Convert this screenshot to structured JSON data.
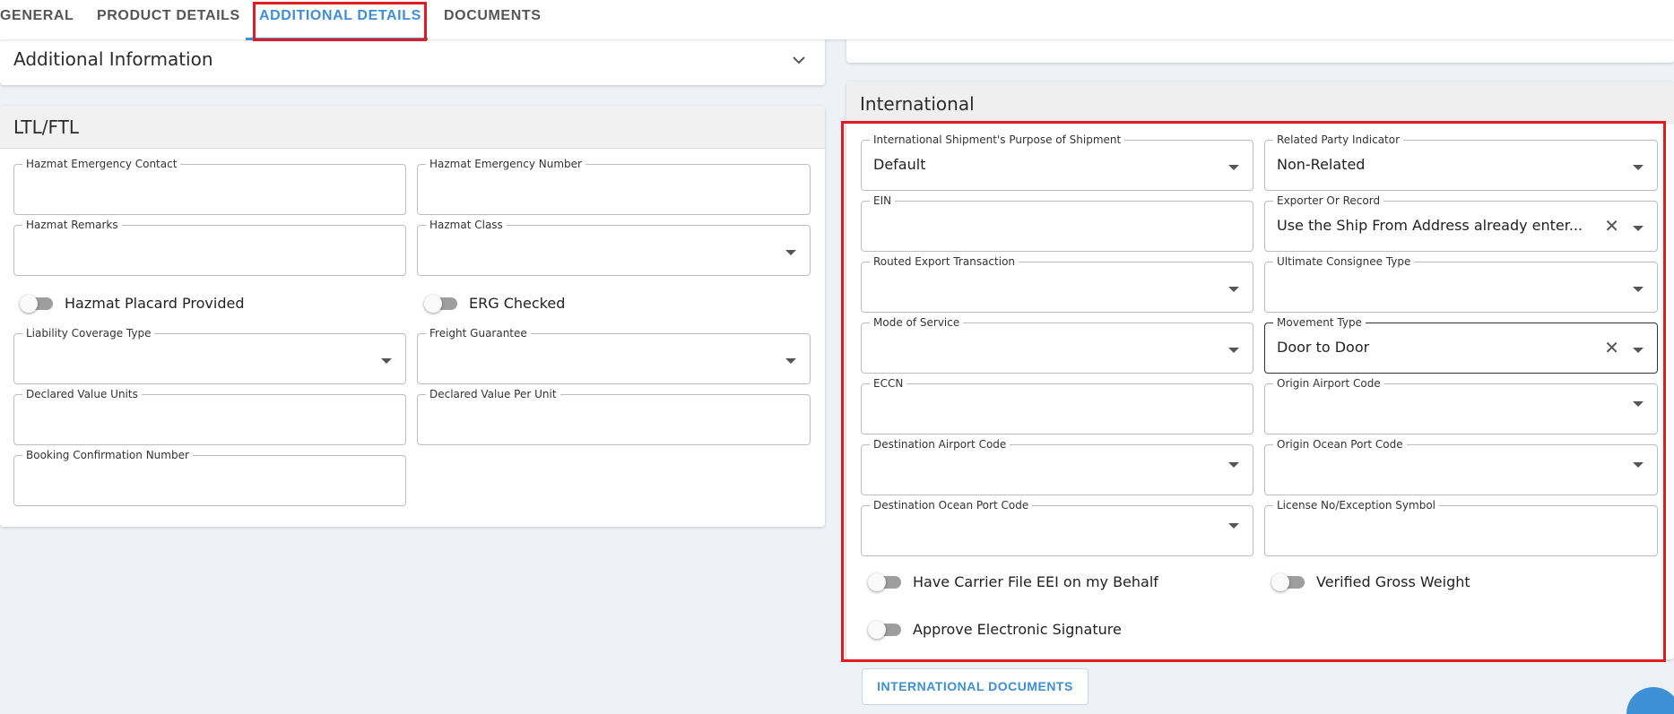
{
  "tabs": [
    {
      "label": "GENERAL"
    },
    {
      "label": "PRODUCT DETAILS"
    },
    {
      "label": "ADDITIONAL DETAILS",
      "active": true
    },
    {
      "label": "DOCUMENTS"
    }
  ],
  "additional_info": {
    "title": "Additional Information"
  },
  "ltl": {
    "title": "LTL/FTL",
    "fields": {
      "hazmat_emergency_contact": {
        "label": "Hazmat Emergency Contact",
        "value": ""
      },
      "hazmat_emergency_number": {
        "label": "Hazmat Emergency Number",
        "value": ""
      },
      "hazmat_remarks": {
        "label": "Hazmat Remarks",
        "value": ""
      },
      "hazmat_class": {
        "label": "Hazmat Class",
        "value": ""
      },
      "liability_coverage_type": {
        "label": "Liability Coverage Type",
        "value": ""
      },
      "freight_guarantee": {
        "label": "Freight Guarantee",
        "value": ""
      },
      "declared_value_units": {
        "label": "Declared Value Units",
        "value": ""
      },
      "declared_value_per_unit": {
        "label": "Declared Value Per Unit",
        "value": ""
      },
      "booking_confirmation_number": {
        "label": "Booking Confirmation Number",
        "value": ""
      }
    },
    "toggles": {
      "hazmat_placard_provided": {
        "label": "Hazmat Placard Provided",
        "on": false
      },
      "erg_checked": {
        "label": "ERG Checked",
        "on": false
      }
    }
  },
  "international": {
    "title": "International",
    "fields": {
      "purpose_of_shipment": {
        "label": "International Shipment's Purpose of Shipment",
        "value": "Default"
      },
      "related_party_indicator": {
        "label": "Related Party Indicator",
        "value": "Non-Related"
      },
      "ein": {
        "label": "EIN",
        "value": ""
      },
      "exporter_of_record": {
        "label": "Exporter Or Record",
        "value": "Use the Ship From Address already enter..."
      },
      "routed_export_transaction": {
        "label": "Routed Export Transaction",
        "value": ""
      },
      "ultimate_consignee_type": {
        "label": "Ultimate Consignee Type",
        "value": ""
      },
      "mode_of_service": {
        "label": "Mode of Service",
        "value": ""
      },
      "movement_type": {
        "label": "Movement Type",
        "value": "Door to Door"
      },
      "eccn": {
        "label": "ECCN",
        "value": ""
      },
      "origin_airport_code": {
        "label": "Origin Airport Code",
        "value": ""
      },
      "destination_airport_code": {
        "label": "Destination Airport Code",
        "value": ""
      },
      "origin_ocean_port_code": {
        "label": "Origin Ocean Port Code",
        "value": ""
      },
      "destination_ocean_port_code": {
        "label": "Destination Ocean Port Code",
        "value": ""
      },
      "license_no_exception_symbol": {
        "label": "License No/Exception Symbol",
        "value": ""
      }
    },
    "toggles": {
      "carrier_file_eei": {
        "label": "Have Carrier File EEI on my Behalf",
        "on": false
      },
      "verified_gross_weight": {
        "label": "Verified Gross Weight",
        "on": false
      },
      "approve_electronic_signature": {
        "label": "Approve Electronic Signature",
        "on": false
      }
    },
    "documents_button": "INTERNATIONAL DOCUMENTS"
  },
  "colors": {
    "accent": "#3d8fd6",
    "highlight": "#e01b22"
  },
  "icons": [
    "chevron-down-icon",
    "dropdown-caret-icon",
    "clear-icon",
    "chat-icon"
  ]
}
